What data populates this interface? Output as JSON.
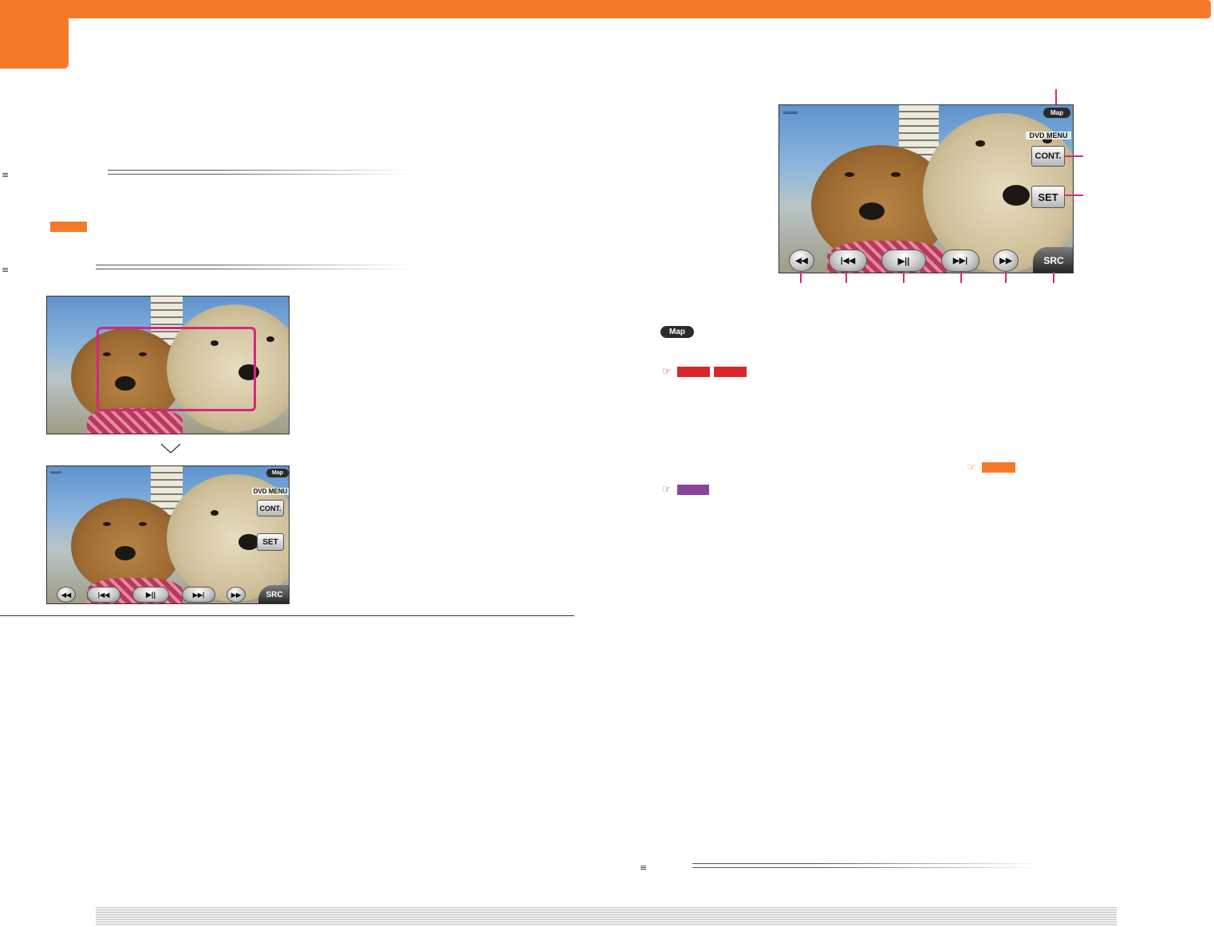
{
  "colors": {
    "accent": "#f47a2a",
    "callout": "#d3287d",
    "ref_red": "#d9262a",
    "ref_purple": "#8b449c"
  },
  "icons": [
    "menu-lines-icon",
    "reference-hand-icon",
    "play-pause-icon",
    "rewind-icon",
    "fast-forward-icon",
    "previous-chapter-icon",
    "next-chapter-icon",
    "disc-icon"
  ],
  "screens": {
    "labels": {
      "map": "Map",
      "dvd_menu": "DVD MENU",
      "cont": "CONT.",
      "set": "SET",
      "src": "SRC",
      "rewind": "◀◀",
      "prev": "|◀◀",
      "playpause": "▶||",
      "next": "▶▶|",
      "forward": "▶▶"
    }
  },
  "map_icon_label": "Map",
  "section_marker": "≡",
  "ref_glyph": "☞"
}
